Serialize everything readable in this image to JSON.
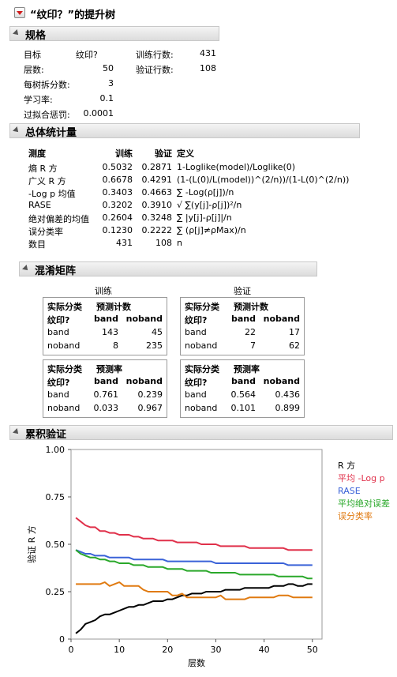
{
  "title": "“纹印？”的提升树",
  "spec": {
    "header": "规格",
    "rows_left": [
      {
        "label": "目标",
        "value": "纹印?"
      },
      {
        "label": "层数:",
        "value": "50"
      },
      {
        "label": "每树拆分数:",
        "value": "3"
      },
      {
        "label": "学习率:",
        "value": "0.1"
      },
      {
        "label": "过拟合惩罚:",
        "value": "0.0001"
      }
    ],
    "rows_right": [
      {
        "label": "训练行数:",
        "value": "431"
      },
      {
        "label": "验证行数:",
        "value": "108"
      }
    ]
  },
  "overall": {
    "header": "总体统计量",
    "columns": [
      "测度",
      "训练",
      "验证",
      "定义"
    ],
    "rows": [
      {
        "measure": "熵 R 方",
        "train": "0.5032",
        "valid": "0.2871",
        "def": "1-Loglike(model)/Loglike(0)"
      },
      {
        "measure": "广义 R 方",
        "train": "0.6678",
        "valid": "0.4291",
        "def": "(1-(L(0)/L(model))^(2/n))/(1-L(0)^(2/n))"
      },
      {
        "measure": "-Log p 均值",
        "train": "0.3403",
        "valid": "0.4663",
        "def": "∑ -Log(ρ[j])/n"
      },
      {
        "measure": "RASE",
        "train": "0.3202",
        "valid": "0.3910",
        "def": "√ ∑(y[j]-ρ[j])²/n"
      },
      {
        "measure": "绝对偏差的均值",
        "train": "0.2604",
        "valid": "0.3248",
        "def": "∑ |y[j]-ρ[j]|/n"
      },
      {
        "measure": "误分类率",
        "train": "0.1230",
        "valid": "0.2222",
        "def": "∑ (ρ[j]≠ρMax)/n"
      },
      {
        "measure": "数目",
        "train": "431",
        "valid": "108",
        "def": "n"
      }
    ]
  },
  "confusion": {
    "header": "混淆矩阵",
    "train_label": "训练",
    "valid_label": "验证",
    "actual_label": "实际分类",
    "count_label": "预测计数",
    "rate_label": "预测率",
    "row_var": "纹印?",
    "classes": [
      "band",
      "noband"
    ],
    "train_counts": [
      [
        "143",
        "45"
      ],
      [
        "8",
        "235"
      ]
    ],
    "valid_counts": [
      [
        "22",
        "17"
      ],
      [
        "7",
        "62"
      ]
    ],
    "train_rates": [
      [
        "0.761",
        "0.239"
      ],
      [
        "0.033",
        "0.967"
      ]
    ],
    "valid_rates": [
      [
        "0.564",
        "0.436"
      ],
      [
        "0.101",
        "0.899"
      ]
    ]
  },
  "cumulative": {
    "header": "累积验证"
  },
  "colors": {
    "rsq": "#000000",
    "logp": "#e0304a",
    "rase": "#3a62d8",
    "mad": "#2aa82a",
    "misclass": "#e07a10",
    "disclosure_red": "#d01c1c"
  },
  "chart_data": {
    "type": "line",
    "xlabel": "层数",
    "ylabel": "验证 R 方",
    "xlim": [
      0,
      52
    ],
    "ylim": [
      0,
      1
    ],
    "xticks": [
      0,
      10,
      20,
      30,
      40,
      50
    ],
    "yticks": [
      "0",
      "0.25",
      "0.50",
      "0.75",
      "1.00"
    ],
    "legend_placement": "right",
    "series": [
      {
        "name": "R 方",
        "color_key": "rsq",
        "x": [
          1,
          2,
          3,
          4,
          5,
          6,
          7,
          8,
          9,
          10,
          11,
          12,
          13,
          14,
          15,
          16,
          17,
          18,
          19,
          20,
          21,
          22,
          23,
          24,
          25,
          26,
          27,
          28,
          29,
          30,
          31,
          32,
          33,
          34,
          35,
          36,
          37,
          38,
          39,
          40,
          41,
          42,
          43,
          44,
          45,
          46,
          47,
          48,
          49,
          50
        ],
        "y": [
          0.03,
          0.05,
          0.08,
          0.09,
          0.1,
          0.12,
          0.13,
          0.13,
          0.14,
          0.15,
          0.16,
          0.17,
          0.17,
          0.18,
          0.18,
          0.19,
          0.2,
          0.2,
          0.2,
          0.21,
          0.21,
          0.22,
          0.23,
          0.23,
          0.24,
          0.24,
          0.24,
          0.25,
          0.25,
          0.25,
          0.25,
          0.26,
          0.26,
          0.26,
          0.26,
          0.27,
          0.27,
          0.27,
          0.27,
          0.27,
          0.27,
          0.28,
          0.28,
          0.28,
          0.29,
          0.29,
          0.28,
          0.28,
          0.29,
          0.29
        ]
      },
      {
        "name": "平均 -Log p",
        "color_key": "logp",
        "x": [
          1,
          2,
          3,
          4,
          5,
          6,
          7,
          8,
          9,
          10,
          11,
          12,
          13,
          14,
          15,
          16,
          17,
          18,
          19,
          20,
          21,
          22,
          23,
          24,
          25,
          26,
          27,
          28,
          29,
          30,
          31,
          32,
          33,
          34,
          35,
          36,
          37,
          38,
          39,
          40,
          41,
          42,
          43,
          44,
          45,
          46,
          47,
          48,
          49,
          50
        ],
        "y": [
          0.64,
          0.62,
          0.6,
          0.59,
          0.59,
          0.57,
          0.57,
          0.56,
          0.56,
          0.55,
          0.55,
          0.55,
          0.54,
          0.54,
          0.53,
          0.53,
          0.53,
          0.52,
          0.52,
          0.52,
          0.52,
          0.51,
          0.51,
          0.51,
          0.51,
          0.51,
          0.5,
          0.5,
          0.5,
          0.5,
          0.49,
          0.49,
          0.49,
          0.49,
          0.49,
          0.49,
          0.48,
          0.48,
          0.48,
          0.48,
          0.48,
          0.48,
          0.48,
          0.48,
          0.47,
          0.47,
          0.47,
          0.47,
          0.47,
          0.47
        ]
      },
      {
        "name": "RASE",
        "color_key": "rase",
        "x": [
          1,
          2,
          3,
          4,
          5,
          6,
          7,
          8,
          9,
          10,
          11,
          12,
          13,
          14,
          15,
          16,
          17,
          18,
          19,
          20,
          21,
          22,
          23,
          24,
          25,
          26,
          27,
          28,
          29,
          30,
          31,
          32,
          33,
          34,
          35,
          36,
          37,
          38,
          39,
          40,
          41,
          42,
          43,
          44,
          45,
          46,
          47,
          48,
          49,
          50
        ],
        "y": [
          0.47,
          0.46,
          0.45,
          0.45,
          0.44,
          0.44,
          0.44,
          0.43,
          0.43,
          0.43,
          0.43,
          0.43,
          0.42,
          0.42,
          0.42,
          0.42,
          0.42,
          0.42,
          0.42,
          0.41,
          0.41,
          0.41,
          0.41,
          0.41,
          0.41,
          0.41,
          0.41,
          0.41,
          0.41,
          0.4,
          0.4,
          0.4,
          0.4,
          0.4,
          0.4,
          0.4,
          0.4,
          0.4,
          0.4,
          0.4,
          0.4,
          0.4,
          0.4,
          0.4,
          0.39,
          0.39,
          0.39,
          0.39,
          0.39,
          0.39
        ]
      },
      {
        "name": "平均绝对误差",
        "color_key": "mad",
        "x": [
          1,
          2,
          3,
          4,
          5,
          6,
          7,
          8,
          9,
          10,
          11,
          12,
          13,
          14,
          15,
          16,
          17,
          18,
          19,
          20,
          21,
          22,
          23,
          24,
          25,
          26,
          27,
          28,
          29,
          30,
          31,
          32,
          33,
          34,
          35,
          36,
          37,
          38,
          39,
          40,
          41,
          42,
          43,
          44,
          45,
          46,
          47,
          48,
          49,
          50
        ],
        "y": [
          0.47,
          0.45,
          0.44,
          0.43,
          0.43,
          0.42,
          0.42,
          0.41,
          0.41,
          0.4,
          0.4,
          0.4,
          0.39,
          0.39,
          0.39,
          0.38,
          0.38,
          0.38,
          0.38,
          0.37,
          0.37,
          0.37,
          0.37,
          0.36,
          0.36,
          0.36,
          0.36,
          0.36,
          0.35,
          0.35,
          0.35,
          0.35,
          0.35,
          0.35,
          0.34,
          0.34,
          0.34,
          0.34,
          0.34,
          0.34,
          0.34,
          0.34,
          0.33,
          0.33,
          0.33,
          0.33,
          0.33,
          0.33,
          0.32,
          0.32
        ]
      },
      {
        "name": "误分类率",
        "color_key": "misclass",
        "x": [
          1,
          2,
          3,
          4,
          5,
          6,
          7,
          8,
          9,
          10,
          11,
          12,
          13,
          14,
          15,
          16,
          17,
          18,
          19,
          20,
          21,
          22,
          23,
          24,
          25,
          26,
          27,
          28,
          29,
          30,
          31,
          32,
          33,
          34,
          35,
          36,
          37,
          38,
          39,
          40,
          41,
          42,
          43,
          44,
          45,
          46,
          47,
          48,
          49,
          50
        ],
        "y": [
          0.29,
          0.29,
          0.29,
          0.29,
          0.29,
          0.29,
          0.3,
          0.28,
          0.29,
          0.3,
          0.28,
          0.28,
          0.28,
          0.28,
          0.26,
          0.25,
          0.25,
          0.25,
          0.25,
          0.25,
          0.23,
          0.23,
          0.24,
          0.22,
          0.22,
          0.22,
          0.22,
          0.22,
          0.22,
          0.22,
          0.23,
          0.21,
          0.21,
          0.21,
          0.21,
          0.21,
          0.22,
          0.22,
          0.22,
          0.22,
          0.22,
          0.22,
          0.23,
          0.23,
          0.23,
          0.22,
          0.22,
          0.22,
          0.22,
          0.22
        ]
      }
    ]
  }
}
